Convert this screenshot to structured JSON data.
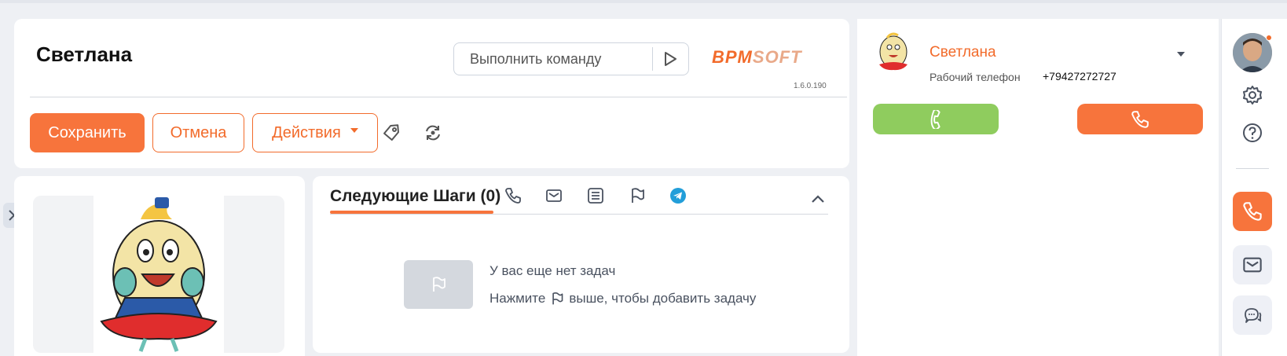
{
  "header": {
    "title": "Светлана",
    "command_placeholder": "Выполнить команду",
    "logo_bold": "BPM",
    "logo_light": "SOFT",
    "version": "1.6.0.190"
  },
  "toolbar": {
    "save_label": "Сохранить",
    "cancel_label": "Отмена",
    "actions_label": "Действия"
  },
  "next_steps": {
    "title": "Следующие Шаги (0)",
    "empty_line1": "У вас еще нет задач",
    "empty_line2_before": "Нажмите",
    "empty_line2_after": "выше, чтобы добавить задачу"
  },
  "call_panel": {
    "contact_name": "Светлана",
    "phone_type": "Рабочий телефон",
    "phone_number": "+79427272727"
  },
  "colors": {
    "accent": "#f7743c",
    "accept": "#8fcc5e",
    "telegram": "#229ed9"
  },
  "icons": {
    "command_run": "play-icon",
    "tag": "tag-icon",
    "refresh": "refresh-icon",
    "expand": "double-chevron-right-icon",
    "tabs": [
      "phone-icon",
      "mail-icon",
      "list-icon",
      "flag-icon",
      "telegram-icon"
    ],
    "rail": [
      "gear-icon",
      "help-icon",
      "phone-icon",
      "mail-icon",
      "chat-icon"
    ]
  }
}
